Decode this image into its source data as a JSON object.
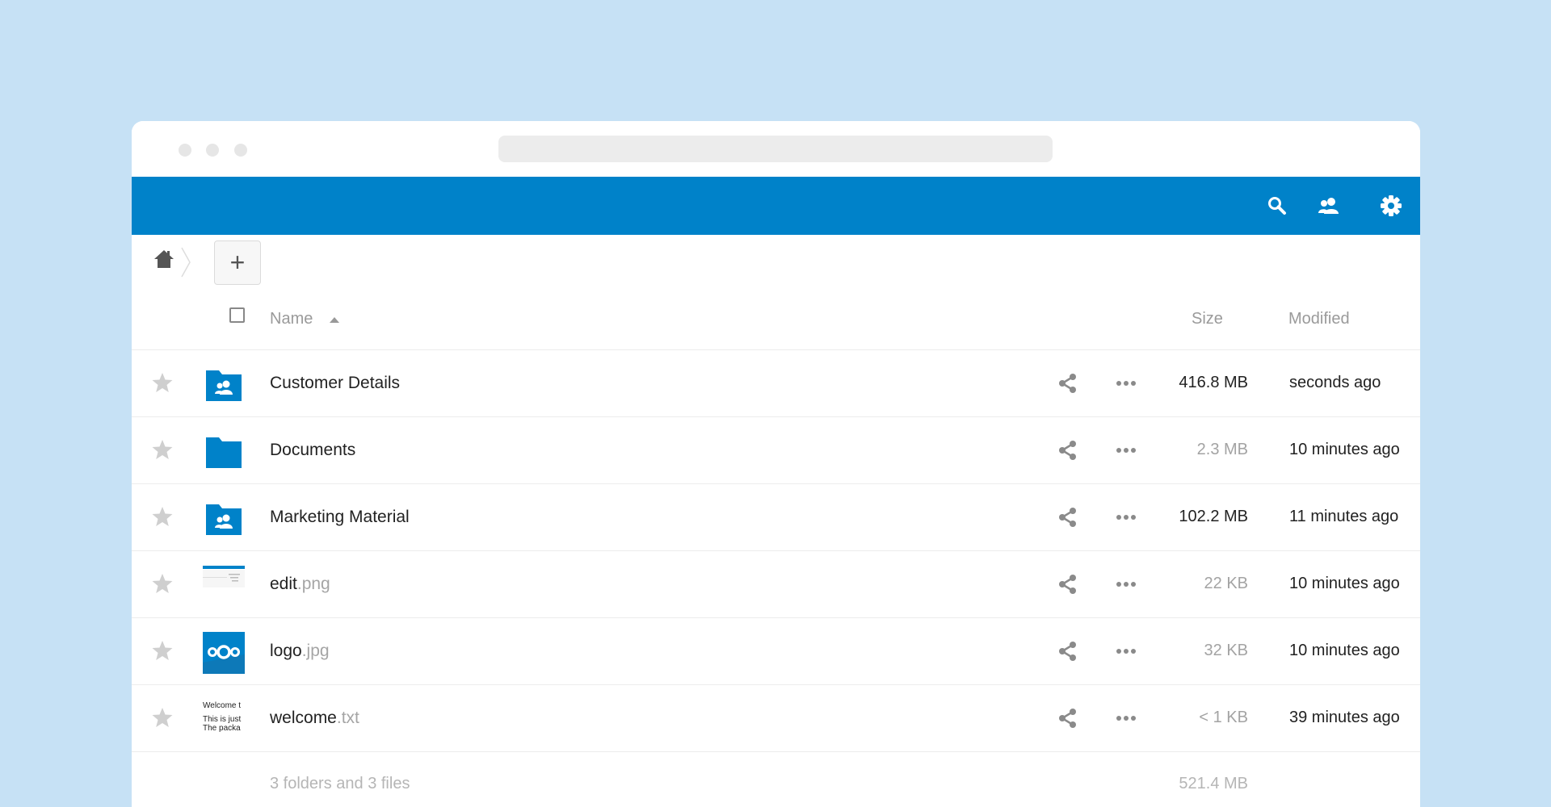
{
  "header": {
    "icons": [
      "search-icon",
      "contacts-icon",
      "settings-icon"
    ]
  },
  "toolbar": {
    "new_label": "+"
  },
  "columns": {
    "name": "Name",
    "size": "Size",
    "modified": "Modified"
  },
  "files": [
    {
      "base": "Customer Details",
      "ext": "",
      "type": "shared-folder",
      "size": "416.8 MB",
      "modified": "seconds ago",
      "size_color": "#222222"
    },
    {
      "base": "Documents",
      "ext": "",
      "type": "folder",
      "size": "2.3 MB",
      "modified": "10 minutes ago",
      "size_color": "#a3a3a3"
    },
    {
      "base": "Marketing Material",
      "ext": "",
      "type": "shared-folder",
      "size": "102.2 MB",
      "modified": "11 minutes ago",
      "size_color": "#222222"
    },
    {
      "base": "edit",
      "ext": ".png",
      "type": "image-thumbnail",
      "size": "22 KB",
      "modified": "10 minutes ago",
      "size_color": "#a3a3a3"
    },
    {
      "base": "logo",
      "ext": ".jpg",
      "type": "logo-thumbnail",
      "size": "32 KB",
      "modified": "10 minutes ago",
      "size_color": "#a3a3a3"
    },
    {
      "base": "welcome",
      "ext": ".txt",
      "type": "text-thumbnail",
      "size": "< 1 KB",
      "modified": "39 minutes ago",
      "size_color": "#a3a3a3"
    }
  ],
  "text_thumbnail": {
    "line1": "Welcome t",
    "line2": "This is just",
    "line3": "The packa"
  },
  "summary": {
    "text": "3 folders and 3 files",
    "total_size": "521.4 MB"
  },
  "colors": {
    "accent": "#0082c9",
    "background": "#c6e1f5"
  }
}
